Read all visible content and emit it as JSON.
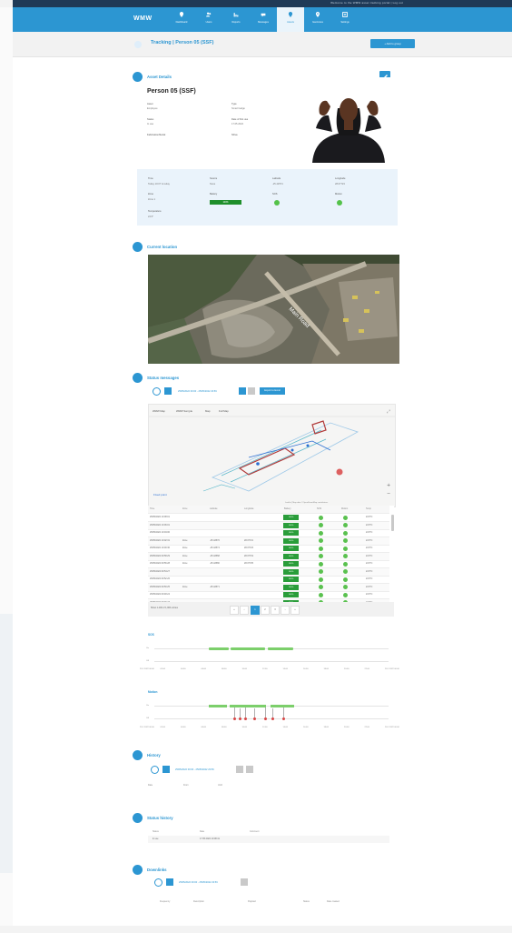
{
  "app": {
    "logo": "WMW"
  },
  "topbar": {
    "text": "Welcome to the WMW asset tracking portal | Log out"
  },
  "nav": [
    {
      "label": "Dashboard",
      "icon": "pin-icon"
    },
    {
      "label": "Users",
      "icon": "users-icon"
    },
    {
      "label": "Reports",
      "icon": "chart-icon"
    },
    {
      "label": "Messages",
      "icon": "messages-icon"
    },
    {
      "label": "Assets",
      "icon": "asset-pin-icon",
      "active": true
    },
    {
      "label": "Geozones",
      "icon": "geozone-icon"
    },
    {
      "label": "Settings",
      "icon": "settings-icon"
    }
  ],
  "subheader": {
    "title": "Tracking | Person 05 (SSF)",
    "button": "+ Add to group"
  },
  "asset_details": {
    "section_title": "Asset Details",
    "name": "Person 05 (SSF)",
    "fields": [
      {
        "label": "Asset",
        "value": "Employee"
      },
      {
        "label": "Type",
        "value": "Smart badge"
      },
      {
        "label": "Status",
        "value": "In use"
      },
      {
        "label": "Date of first use",
        "value": "17.05.2022"
      },
      {
        "label": "Fabrication/Serial",
        "value": ""
      },
      {
        "label": "Shiva",
        "value": ""
      }
    ]
  },
  "status_box": {
    "fields": [
      {
        "label": "Time",
        "value": "Today 10:07 Is today"
      },
      {
        "label": "Source",
        "value": "None"
      },
      {
        "label": "Latitude",
        "value": "-25.42574"
      },
      {
        "label": "Longitude",
        "value": "28.07723"
      },
      {
        "label": "Zone",
        "value": "Zone 1"
      },
      {
        "label": "Battery",
        "value": "100%"
      },
      {
        "label": "SOS",
        "value": ""
      },
      {
        "label": "Motion",
        "value": ""
      },
      {
        "label": "Temperature",
        "value": "24.5°"
      }
    ]
  },
  "location": {
    "section_title": "Current location",
    "road_label": "Main Road"
  },
  "status_messages": {
    "section_title": "Status messages",
    "date_range": "25/05/2022 00:00 - 25/05/2022 23:59",
    "export_button": "Export to Excel",
    "map_tabs": [
      "WMW Map",
      "WMW Sat (ple",
      "Map",
      "Full Map"
    ],
    "map_legend": "Fixed point",
    "map_attribution": "Leaflet | Map data ©OpenStreetMap contributors",
    "columns": [
      "Time",
      "Zone",
      "Latitude",
      "Longitude",
      "Battery",
      "SOS",
      "Motion",
      "Temp"
    ],
    "rows": [
      {
        "time": "25/05/2022 10:08:01",
        "zone": "",
        "lat": "",
        "lon": "",
        "batt": "100%",
        "temp": "24.5°C"
      },
      {
        "time": "25/05/2022 10:06:01",
        "zone": "",
        "lat": "",
        "lon": "",
        "batt": "100%",
        "temp": "24.5°C"
      },
      {
        "time": "25/05/2022 10:04:00",
        "zone": "",
        "lat": "",
        "lon": "",
        "batt": "100%",
        "temp": "24.5°C"
      },
      {
        "time": "25/05/2022 10:02:31",
        "zone": "Zone",
        "lat": "-25.42570",
        "lon": "28.07721",
        "batt": "100%",
        "temp": "24.5°C"
      },
      {
        "time": "25/05/2022 10:00:30",
        "zone": "Zone",
        "lat": "-25.42574",
        "lon": "28.07723",
        "batt": "100%",
        "temp": "24.5°C"
      },
      {
        "time": "25/05/2022 09:58:29",
        "zone": "Zone",
        "lat": "-25.42568",
        "lon": "28.07719",
        "batt": "100%",
        "temp": "24.5°C"
      },
      {
        "time": "25/05/2022 09:56:28",
        "zone": "Zone",
        "lat": "-25.42580",
        "lon": "28.07725",
        "batt": "100%",
        "temp": "24.5°C"
      },
      {
        "time": "25/05/2022 09:54:27",
        "zone": "",
        "lat": "",
        "lon": "",
        "batt": "100%",
        "temp": "24.5°C"
      },
      {
        "time": "25/05/2022 09:52:26",
        "zone": "",
        "lat": "",
        "lon": "",
        "batt": "100%",
        "temp": "24.5°C"
      },
      {
        "time": "25/05/2022 09:50:25",
        "zone": "Zone",
        "lat": "-25.42571",
        "lon": "",
        "batt": "100%",
        "temp": "24.5°C"
      },
      {
        "time": "25/05/2022 09:48:24",
        "zone": "",
        "lat": "",
        "lon": "",
        "batt": "100%",
        "temp": "24.5°C"
      },
      {
        "time": "25/05/2022 09:46:23",
        "zone": "",
        "lat": "",
        "lon": "",
        "batt": "100%",
        "temp": "24.5°C"
      }
    ],
    "pager_info": "Show 1-100 of 1,000 entries",
    "pages": [
      "«",
      "‹",
      "1",
      "2",
      "3",
      "›",
      "»"
    ]
  },
  "sos_chart": {
    "title": "SOS",
    "y_labels": [
      "On",
      "Off"
    ],
    "x_labels": [
      "25.1.2022 00:00",
      "02:00",
      "04:00",
      "06:00",
      "08:00",
      "10:00",
      "12:00",
      "14:00",
      "16:00",
      "18:00",
      "20:00",
      "22:00",
      "26.1.2022 00:00"
    ]
  },
  "motion_chart": {
    "title": "Motion",
    "y_labels": [
      "On",
      "Off"
    ],
    "x_labels": [
      "25.1.2022 00:00",
      "02:00",
      "04:00",
      "06:00",
      "08:00",
      "10:00",
      "12:00",
      "14:00",
      "16:00",
      "18:00",
      "20:00",
      "22:00",
      "26.1.2022 00:00"
    ]
  },
  "history": {
    "section_title": "History",
    "date_range": "25/05/2022 00:00 - 25/05/2022 23:59",
    "columns": [
      "Date",
      "From",
      "Until"
    ]
  },
  "status_history": {
    "section_title": "Status history",
    "columns": [
      "Status",
      "Date",
      "Comment"
    ],
    "row": {
      "status": "In use",
      "date": "17.05.2022 10:08:41"
    }
  },
  "downlinks": {
    "section_title": "Downlinks",
    "date_range": "25/05/2022 00:00 - 25/05/2022 23:59",
    "columns": [
      "Frequency",
      "Description",
      "Payload",
      "Status",
      "Date created"
    ]
  }
}
